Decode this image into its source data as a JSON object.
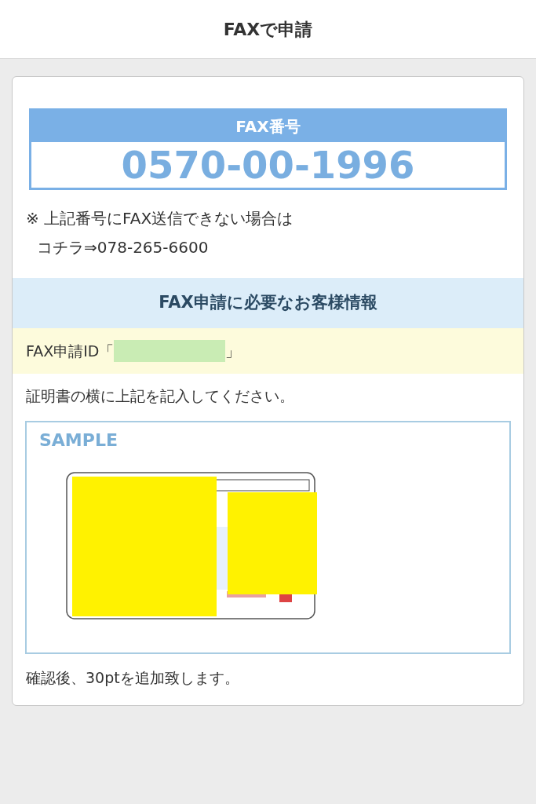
{
  "header": {
    "title": "FAXで申請"
  },
  "fax_box": {
    "label": "FAX番号",
    "number": "0570-00-1996"
  },
  "note": {
    "line_1": "※ 上記番号にFAX送信できない場合は",
    "line_2": "コチラ⇒078-265-6600"
  },
  "section": {
    "title": "FAX申請に必要なお客様情報"
  },
  "application_id": {
    "prefix": "FAX申請ID「",
    "suffix": "」",
    "redacted": true
  },
  "instruction": "証明書の横に上記を記入してください。",
  "sample": {
    "label": "SAMPLE"
  },
  "footer_note": "確認後、30ptを追加致します。"
}
